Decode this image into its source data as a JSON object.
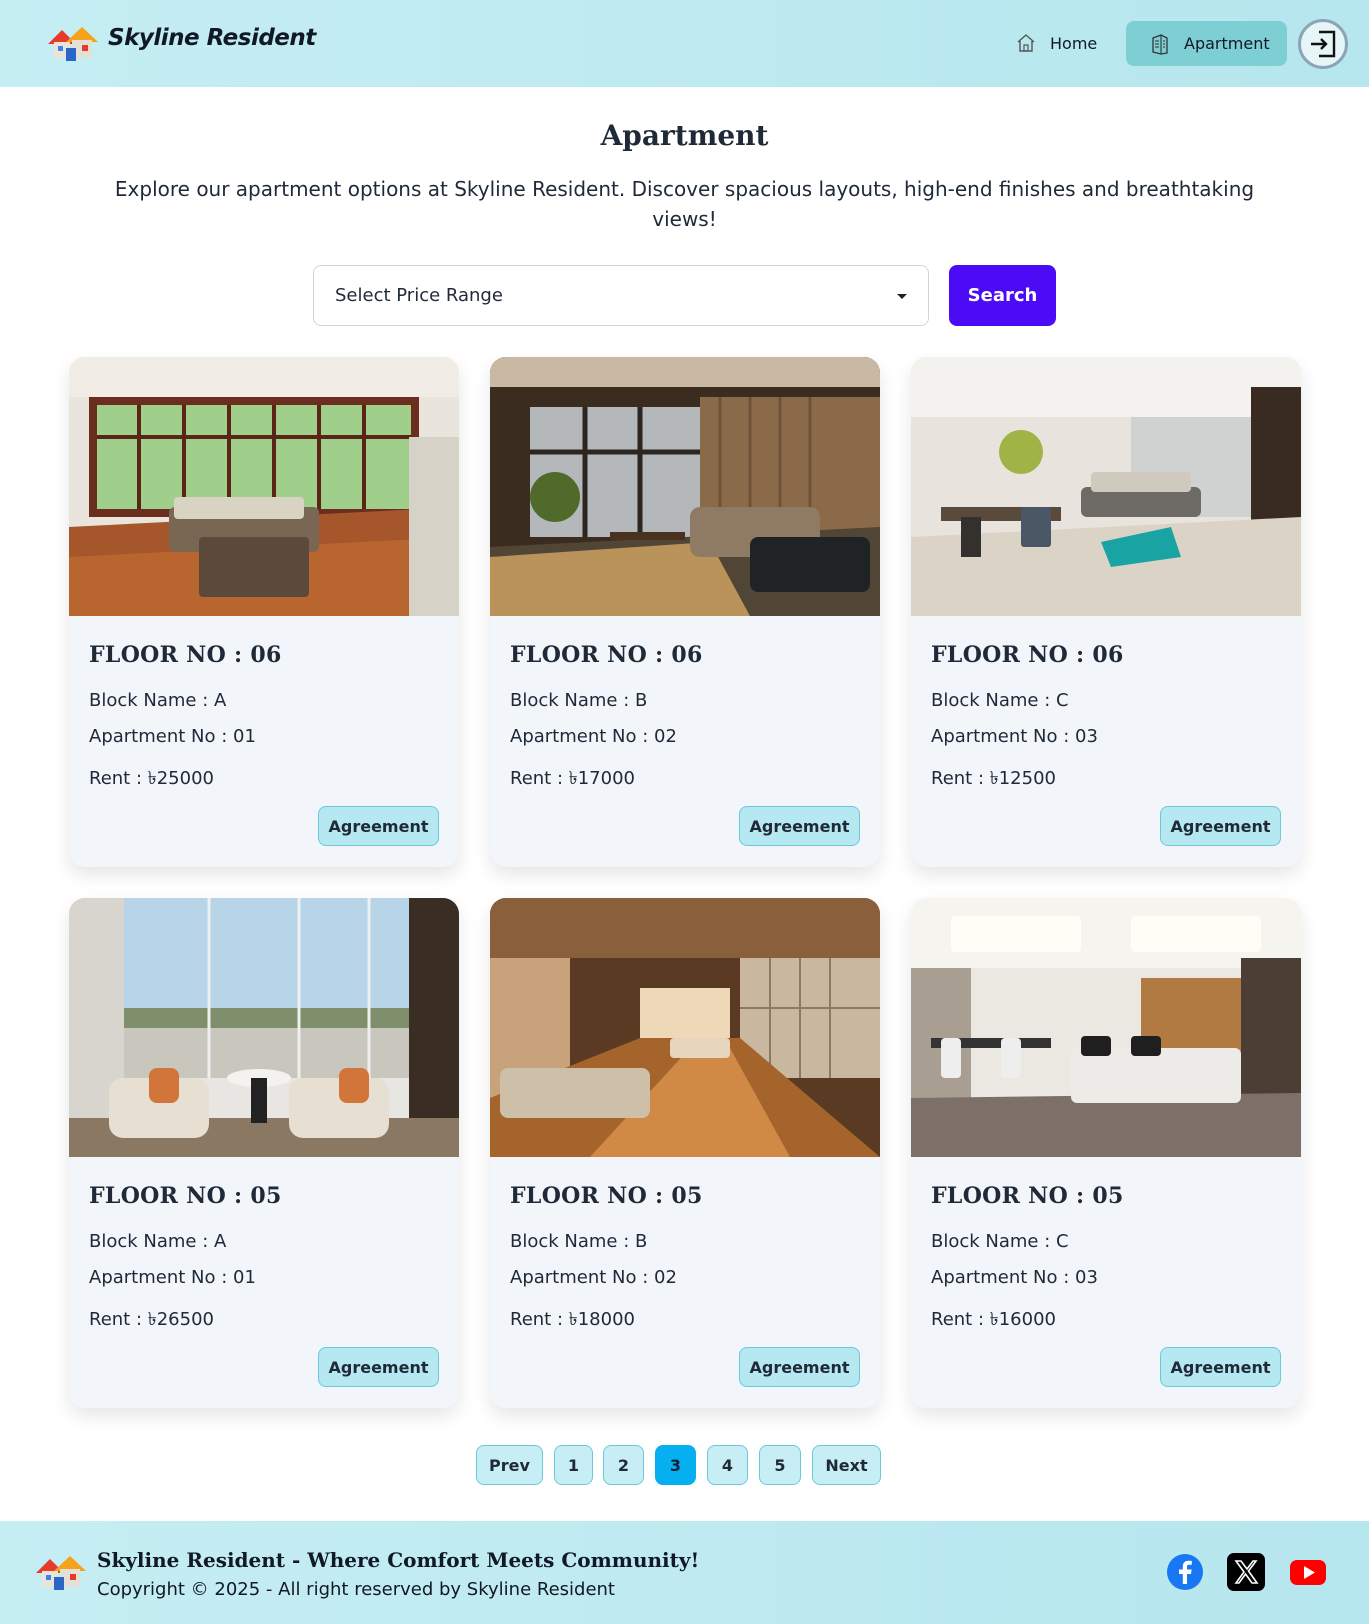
{
  "header": {
    "brand": "Skyline Resident",
    "nav": {
      "home": "Home",
      "apartment": "Apartment"
    }
  },
  "page": {
    "title": "Apartment",
    "description": "Explore our apartment options at Skyline Resident. Discover spacious layouts, high-end finishes and breathtaking views!"
  },
  "filter": {
    "select_value": "Select Price Range",
    "search_label": "Search"
  },
  "cards": [
    {
      "floor": "FLOOR NO : 06",
      "block": "Block Name : A",
      "apartment": "Apartment No : 01",
      "rent_label": "Rent : ",
      "rent_value": "৳25000",
      "button": "Agreement"
    },
    {
      "floor": "FLOOR NO : 06",
      "block": "Block Name : B",
      "apartment": "Apartment No : 02",
      "rent_label": "Rent : ",
      "rent_value": "৳17000",
      "button": "Agreement"
    },
    {
      "floor": "FLOOR NO : 06",
      "block": "Block Name : C",
      "apartment": "Apartment No : 03",
      "rent_label": "Rent : ",
      "rent_value": "৳12500",
      "button": "Agreement"
    },
    {
      "floor": "FLOOR NO : 05",
      "block": "Block Name : A",
      "apartment": "Apartment No : 01",
      "rent_label": "Rent : ",
      "rent_value": "৳26500",
      "button": "Agreement"
    },
    {
      "floor": "FLOOR NO : 05",
      "block": "Block Name : B",
      "apartment": "Apartment No : 02",
      "rent_label": "Rent : ",
      "rent_value": "৳18000",
      "button": "Agreement"
    },
    {
      "floor": "FLOOR NO : 05",
      "block": "Block Name : C",
      "apartment": "Apartment No : 03",
      "rent_label": "Rent : ",
      "rent_value": "৳16000",
      "button": "Agreement"
    }
  ],
  "pagination": {
    "prev": "Prev",
    "pages": [
      "1",
      "2",
      "3",
      "4",
      "5"
    ],
    "active_page": "3",
    "next": "Next"
  },
  "footer": {
    "tagline": "Skyline Resident - Where Comfort Meets Community!",
    "copyright": "Copyright © 2025 - All right reserved by Skyline Resident",
    "social_icons": [
      "facebook-icon",
      "x-icon",
      "youtube-icon"
    ]
  },
  "colors": {
    "header_bg": "#c5eef3",
    "active_nav": "#7ecfd4",
    "search_button": "#4c0bf5",
    "agreement_button": "#b5e8f0",
    "active_page": "#06b0f0"
  }
}
